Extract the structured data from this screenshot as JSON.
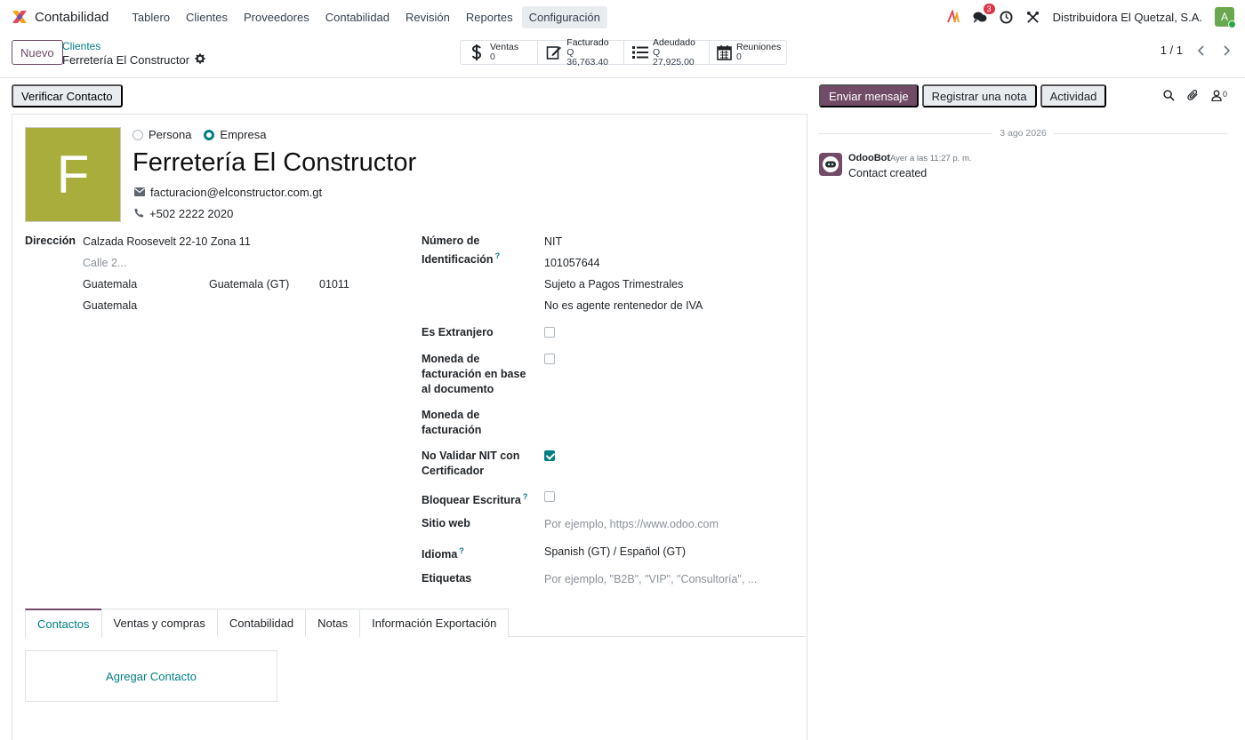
{
  "navbar": {
    "app_name": "Contabilidad",
    "menu": [
      "Tablero",
      "Clientes",
      "Proveedores",
      "Contabilidad",
      "Revisión",
      "Reportes",
      "Configuración"
    ],
    "active_menu_index": 6,
    "messages_badge": "3",
    "company": "Distribuidora El Quetzal, S.A.",
    "user_initial": "A",
    "icons": [
      "app-logo-icon",
      "ai-icon",
      "chat-icon",
      "clock-icon",
      "tools-icon"
    ]
  },
  "control_panel": {
    "new_label": "Nuevo",
    "breadcrumb_parent": "Clientes",
    "breadcrumb_current": "Ferretería El Constructor",
    "stats": [
      {
        "label": "Ventas",
        "value": "0",
        "icon": "dollar-icon"
      },
      {
        "label": "Facturado",
        "value": "Q 36,763.40",
        "icon": "edit-invoice-icon"
      },
      {
        "label": "Adeudado",
        "value": "Q 27,925.00",
        "icon": "list-icon"
      },
      {
        "label": "Reuniones",
        "value": "0",
        "icon": "calendar-icon"
      }
    ],
    "pager": "1 / 1"
  },
  "status_bar": {
    "verify_label": "Verificar Contacto"
  },
  "chatter": {
    "send_message": "Enviar mensaje",
    "log_note": "Registrar una nota",
    "activity": "Actividad",
    "followers_count": "0",
    "date_separator": "3 ago 2026",
    "message": {
      "author": "OdooBot",
      "time": "Ayer a las 11:27 p. m.",
      "body": "Contact created"
    }
  },
  "form": {
    "avatar_letter": "F",
    "company_type_options": [
      "Persona",
      "Empresa"
    ],
    "company_type_selected": "Empresa",
    "name": "Ferretería El Constructor",
    "email": "facturacion@elconstructor.com.gt",
    "phone": "+502 2222 2020",
    "address_label": "Dirección",
    "street": "Calzada Roosevelt 22-10 Zona 11",
    "street2_placeholder": "Calle 2...",
    "city": "Guatemala",
    "state": "Guatemala (GT)",
    "zip": "01011",
    "country": "Guatemala",
    "id_label": "Número de Identificación",
    "id_type": "NIT",
    "vat": "101057644",
    "tax_regime": "Sujeto a Pagos Trimestrales",
    "iva_agent": "No es agente rentenedor de IVA",
    "foreign_label": "Es Extranjero",
    "foreign_checked": false,
    "doc_currency_label": "Moneda de facturación en base al documento",
    "doc_currency_checked": false,
    "currency_label": "Moneda de facturación",
    "no_validate_label": "No Validar NIT con Certificador",
    "no_validate_checked": true,
    "block_label": "Bloquear Escritura",
    "block_checked": false,
    "website_label": "Sitio web",
    "website_placeholder": "Por ejemplo, https://www.odoo.com",
    "lang_label": "Idioma",
    "lang": "Spanish (GT) / Español (GT)",
    "tags_label": "Etiquetas",
    "tags_placeholder": "Por ejemplo, \"B2B\", \"VIP\", \"Consultoría\", ...",
    "help_mark": "?"
  },
  "tabs": [
    "Contactos",
    "Ventas y compras",
    "Contabilidad",
    "Notas",
    "Información Exportación"
  ],
  "active_tab_index": 0,
  "add_contact_label": "Agregar Contacto",
  "colors": {
    "primary": "#714b67",
    "accent": "#017e84",
    "avatar_bg": "#a8ad3c"
  }
}
